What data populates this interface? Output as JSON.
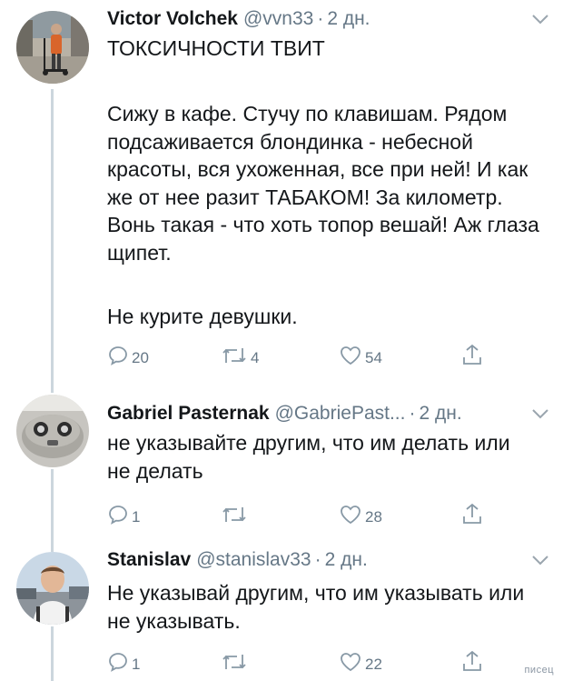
{
  "tweets": [
    {
      "name": "Victor Volchek",
      "handle": "@vvn33",
      "separator": "·",
      "time": "2 дн.",
      "title": "ТОКСИЧНОСТИ ТВИТ",
      "body": "Сижу в кафе. Стучу по клавишам. Рядом подсаживается блондинка - небесной красоты, вся ухоженная, все при ней! И как же от нее разит ТАБАКОМ! За километр. Вонь такая - что хоть топор вешай! Аж глаза щипет.",
      "body2": "Не курите девушки.",
      "replies": "20",
      "retweets": "4",
      "likes": "54"
    },
    {
      "name": "Gabriel Pasternak",
      "handle": "@GabriePast...",
      "separator": "·",
      "time": "2 дн.",
      "body": "не указывайте другим, что им делать или не делать",
      "replies": "1",
      "retweets": "",
      "likes": "28"
    },
    {
      "name": "Stanislav",
      "handle": "@stanislav33",
      "separator": "·",
      "time": "2 дн.",
      "body": "Не указывай другим, что им указывать или не указывать.",
      "replies": "1",
      "retweets": "",
      "likes": "22"
    }
  ],
  "watermark": "писец",
  "icons": {
    "reply": "reply-icon",
    "retweet": "retweet-icon",
    "like": "heart-icon",
    "share": "share-icon",
    "menu": "chevron-down-icon"
  },
  "colors": {
    "text": "#14171a",
    "muted": "#657786",
    "thread": "#ccd6dd"
  }
}
